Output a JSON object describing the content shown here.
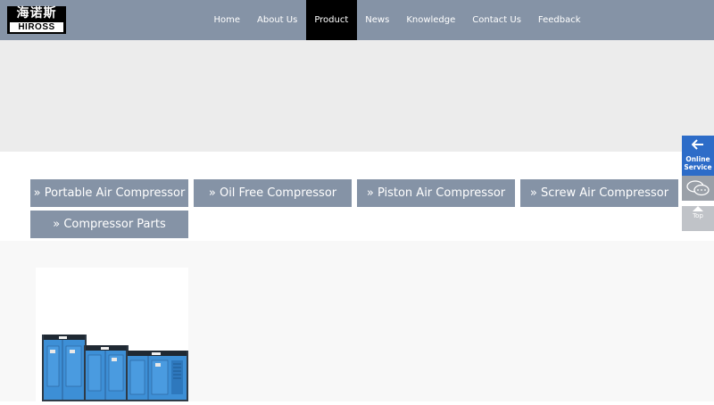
{
  "logo": {
    "chinese": "海诺斯",
    "english": "HIROSS"
  },
  "nav": [
    {
      "label": "Home"
    },
    {
      "label": "About Us"
    },
    {
      "label": "Product",
      "active": true
    },
    {
      "label": "News"
    },
    {
      "label": "Knowledge"
    },
    {
      "label": "Contact Us"
    },
    {
      "label": "Feedback"
    }
  ],
  "categories": [
    {
      "label": "» Portable Air Compressor"
    },
    {
      "label": "» Oil Free Compressor"
    },
    {
      "label": "» Piston Air Compressor"
    },
    {
      "label": "» Screw Air Compressor"
    },
    {
      "label": "» Compressor Parts"
    }
  ],
  "float_bar": {
    "online_label": "Online Service",
    "online_line1": "Online",
    "online_line2": "Service",
    "top_label": "Top"
  },
  "colors": {
    "header_bg": "#8593a6",
    "active_nav": "#000000",
    "category_bg": "#8593a6",
    "online_service": "#2d6cc8",
    "machine_blue": "#3d8fd6"
  },
  "icons": [
    "arrow-left-icon",
    "chat-bubble-icon",
    "arrow-up-icon"
  ]
}
